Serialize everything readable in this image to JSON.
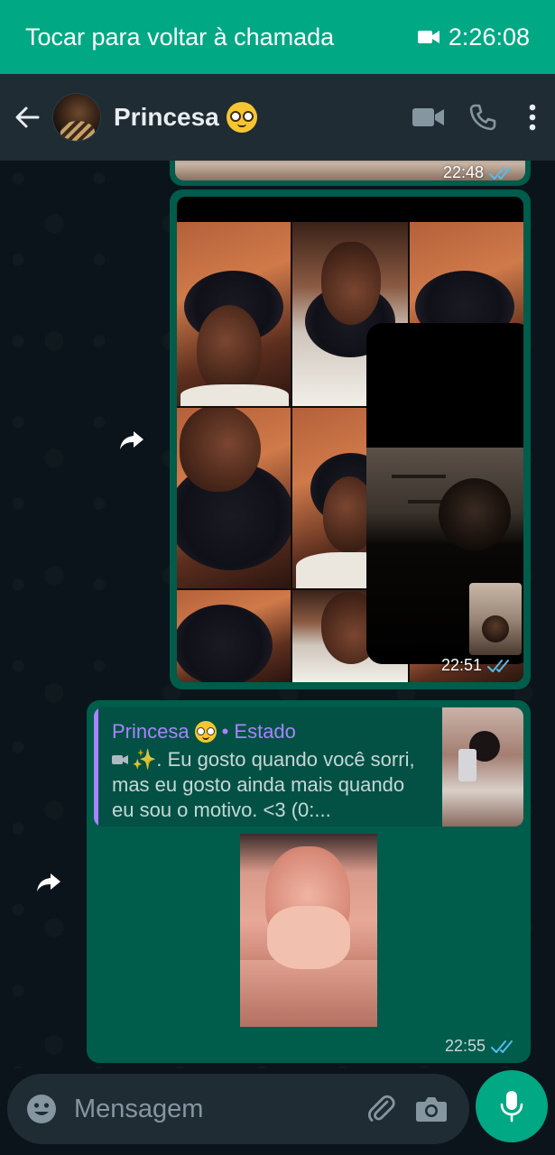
{
  "call_banner": {
    "text": "Tocar para voltar à chamada",
    "duration": "2:26:08"
  },
  "header": {
    "contact_name": "Princesa"
  },
  "messages": [
    {
      "type": "image",
      "time": "22:48"
    },
    {
      "type": "image",
      "time": "22:51"
    },
    {
      "type": "status_reply",
      "quote_author": "Princesa",
      "quote_source": "• Estado",
      "quote_text": "✨. Eu gosto quando você sorri, mas eu gosto ainda mais quando eu sou o motivo.  <3 (0:...",
      "time": "22:55"
    }
  ],
  "composer": {
    "placeholder": "Mensagem"
  },
  "colors": {
    "accent": "#00a884",
    "header_bg": "#1f2c34",
    "chat_bg": "#0b141a",
    "outgoing_bubble": "#005c4b",
    "quote_accent": "#a884ff",
    "read_ticks": "#53bdeb"
  },
  "icons": [
    "video-camera-icon",
    "back-arrow-icon",
    "video-call-icon",
    "phone-icon",
    "more-options-icon",
    "forward-icon",
    "double-check-icon",
    "emoji-icon",
    "attach-icon",
    "camera-icon",
    "mic-icon"
  ]
}
